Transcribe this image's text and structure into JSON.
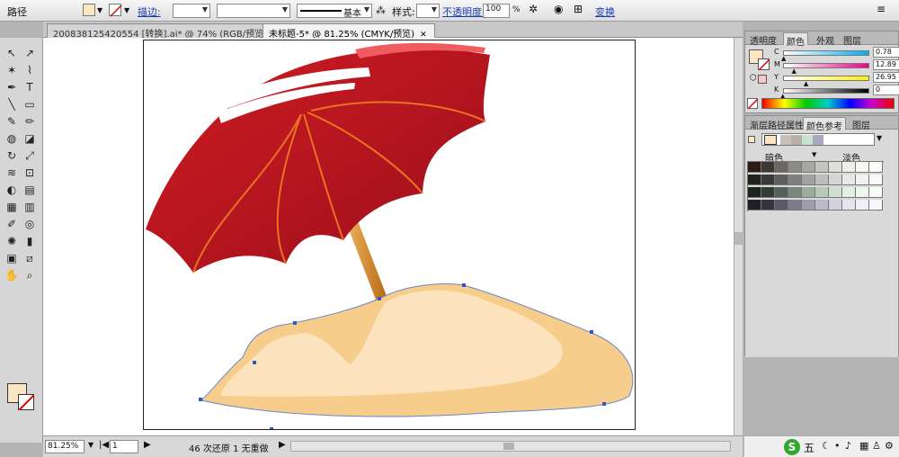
{
  "control_bar": {
    "mode_label": "路径",
    "stroke_label": "描边:",
    "stroke_profile": "基本",
    "style_label": "样式:",
    "opacity_label": "不透明度:",
    "opacity_value": "100",
    "opacity_unit": "%",
    "transform_label": "变换",
    "fill_color": "#fbe5c3"
  },
  "doc_tabs": [
    {
      "label": "200838125420554 [转换].ai* @ 74% (RGB/预览)"
    },
    {
      "label": "未标题-5* @ 81.25% (CMYK/预览)"
    }
  ],
  "tools": [
    "selection-tool",
    "direct-selection-tool",
    "magic-wand-tool",
    "lasso-tool",
    "pen-tool",
    "type-tool",
    "line-tool",
    "rectangle-tool",
    "paintbrush-tool",
    "pencil-tool",
    "blob-brush-tool",
    "eraser-tool",
    "rotate-tool",
    "scale-tool",
    "warp-tool",
    "free-transform-tool",
    "shape-builder-tool",
    "perspective-grid-tool",
    "mesh-tool",
    "gradient-tool",
    "eyedropper-tool",
    "blend-tool",
    "symbol-sprayer-tool",
    "column-graph-tool",
    "artboard-tool",
    "slice-tool",
    "hand-tool",
    "zoom-tool"
  ],
  "status": {
    "zoom": "81.25%",
    "page": "1",
    "undo_text": "46 次还原 1 无重做"
  },
  "color_panel": {
    "tabs": [
      "透明度",
      "颜色",
      "外观",
      "图层"
    ],
    "sliders": [
      {
        "name": "C",
        "value": "0.78",
        "pct": 0.01
      },
      {
        "name": "M",
        "value": "12.89",
        "pct": 0.13
      },
      {
        "name": "Y",
        "value": "26.95",
        "pct": 0.27
      },
      {
        "name": "K",
        "value": "0",
        "pct": 0.0
      }
    ],
    "unit": "%"
  },
  "guide_panel": {
    "tabs": [
      "渐层",
      "路径",
      "属性",
      "颜色参考",
      "图层"
    ],
    "dark_label": "暗色",
    "light_label": "淡色"
  },
  "taskbar": {
    "ime_label": "五"
  }
}
